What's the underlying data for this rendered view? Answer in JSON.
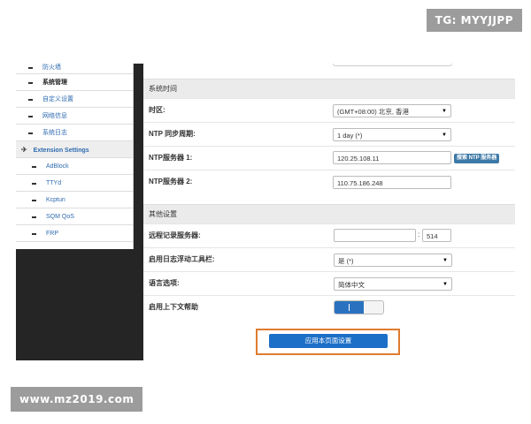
{
  "watermarks": {
    "top_right": "TG: MYYJJPP",
    "bottom_left": "www.mz2019.com"
  },
  "sidebar": {
    "items": [
      {
        "label": "防火墙"
      },
      {
        "label": "系统管理"
      },
      {
        "label": "自定义设置"
      },
      {
        "label": "网络信息"
      },
      {
        "label": "系统日志"
      }
    ],
    "group": {
      "label": "Extension Settings",
      "icon": "airplane-icon"
    },
    "sub_items": [
      {
        "label": "AdBlock"
      },
      {
        "label": "TTYd"
      },
      {
        "label": "Kcptun"
      },
      {
        "label": "SQM QoS"
      },
      {
        "label": "FRP"
      }
    ]
  },
  "content": {
    "section_time": "系统时间",
    "timezone": {
      "label": "时区:",
      "value": "(GMT+08:00) 北京, 香港"
    },
    "ntp_period": {
      "label": "NTP 同步周期:",
      "value": "1 day (*)"
    },
    "ntp1": {
      "label": "NTP服务器 1:",
      "value": "120.25.108.11",
      "button": "搜索 NTP 服务器"
    },
    "ntp2": {
      "label": "NTP服务器 2:",
      "value": "110.75.186.248"
    },
    "section_other": "其他设置",
    "remote_log": {
      "label": "远程记录服务器:",
      "host": "",
      "colon": ":",
      "port": "514"
    },
    "log_toolbar": {
      "label": "启用日志浮动工具栏:",
      "value": "是 (*)"
    },
    "language": {
      "label": "语言选项:",
      "value": "简体中文"
    },
    "context_help": {
      "label": "启用上下文帮助",
      "enabled": true
    },
    "apply_button": "应用本页面设置",
    "caret": "▼"
  },
  "colors": {
    "background_dark": "#252525",
    "link_blue": "#2f6bb0",
    "button_blue": "#1c6fc7",
    "highlight_orange": "#e07b2e"
  }
}
